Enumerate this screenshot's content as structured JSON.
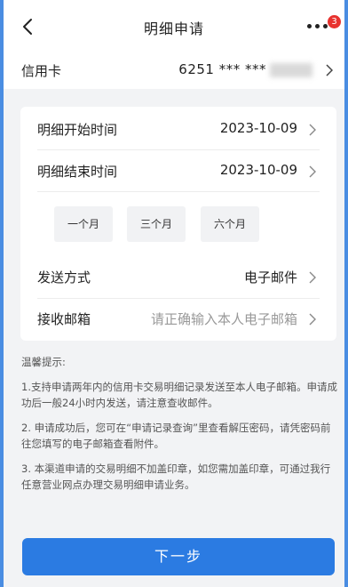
{
  "header": {
    "title": "明细申请",
    "badge_count": "3"
  },
  "card": {
    "label": "信用卡",
    "number": "6251 *** ***"
  },
  "form": {
    "start_label": "明细开始时间",
    "start_value": "2023-10-09",
    "end_label": "明细结束时间",
    "end_value": "2023-10-09",
    "ranges": [
      "一个月",
      "三个月",
      "六个月"
    ],
    "send_label": "发送方式",
    "send_value": "电子邮件",
    "email_label": "接收邮箱",
    "email_placeholder": "请正确输入本人电子邮箱"
  },
  "tips": {
    "title": "温馨提示:",
    "items": [
      "1.支持申请两年内的信用卡交易明细记录发送至本人电子邮箱。申请成功后一般24小时内发送，请注意查收邮件。",
      "2. 申请成功后，您可在“申请记录查询”里查看解压密码，请凭密码前往您填写的电子邮箱查看附件。",
      "3. 本渠道申请的交易明细不加盖印章，如您需加盖印章，可通过我行任意营业网点办理交易明细申请业务。"
    ]
  },
  "footer": {
    "next_label": "下一步"
  },
  "colors": {
    "accent": "#2b7be2",
    "badge": "#e8322e",
    "background": "#f2f3f5"
  }
}
